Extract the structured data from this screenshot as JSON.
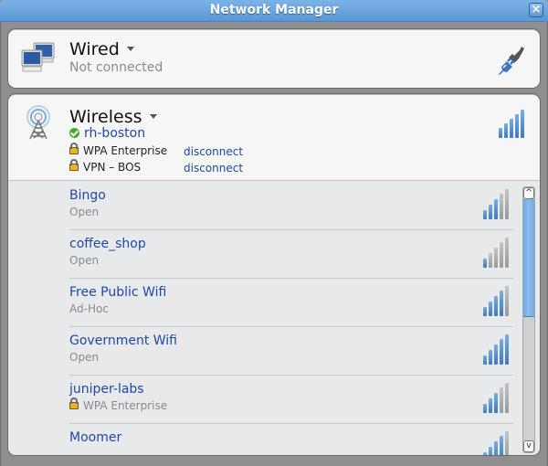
{
  "window": {
    "title": "Network Manager",
    "close_icon": "close-icon"
  },
  "wired": {
    "title": "Wired",
    "status": "Not connected",
    "icon": "network-wired-icon",
    "action_icon": "plug-icon"
  },
  "wireless": {
    "title": "Wireless",
    "icon": "wireless-tower-icon",
    "connected_network": "rh-boston",
    "connected_status_icon": "check-icon",
    "signal_strength_bars": 5,
    "signal_max_bars": 5,
    "connections": [
      {
        "label": "WPA Enterprise",
        "action": "disconnect",
        "icon": "lock-icon"
      },
      {
        "label": "VPN – BOS",
        "action": "disconnect",
        "icon": "lock-icon"
      }
    ],
    "networks": [
      {
        "name": "Bingo",
        "security": "Open",
        "secured": false,
        "signal": 3
      },
      {
        "name": "coffee_shop",
        "security": "Open",
        "secured": false,
        "signal": 1
      },
      {
        "name": "Free Public Wifi",
        "security": "Ad-Hoc",
        "secured": false,
        "signal": 4
      },
      {
        "name": "Government Wifi",
        "security": "Open",
        "secured": false,
        "signal": 5
      },
      {
        "name": "juniper-labs",
        "security": "WPA Enterprise",
        "secured": true,
        "signal": 3
      },
      {
        "name": "Moomer",
        "security": "",
        "secured": false,
        "signal": 4
      }
    ]
  },
  "scrollbar": {
    "up_glyph": "^",
    "down_glyph": "v",
    "position_fraction": 0.0,
    "visible_fraction": 0.45
  },
  "colors": {
    "title_bar": "#5a97d4",
    "link": "#1f48a6",
    "signal_on": "#3f78bf",
    "signal_off": "#9a9a9a",
    "connected": "#3fae29"
  }
}
